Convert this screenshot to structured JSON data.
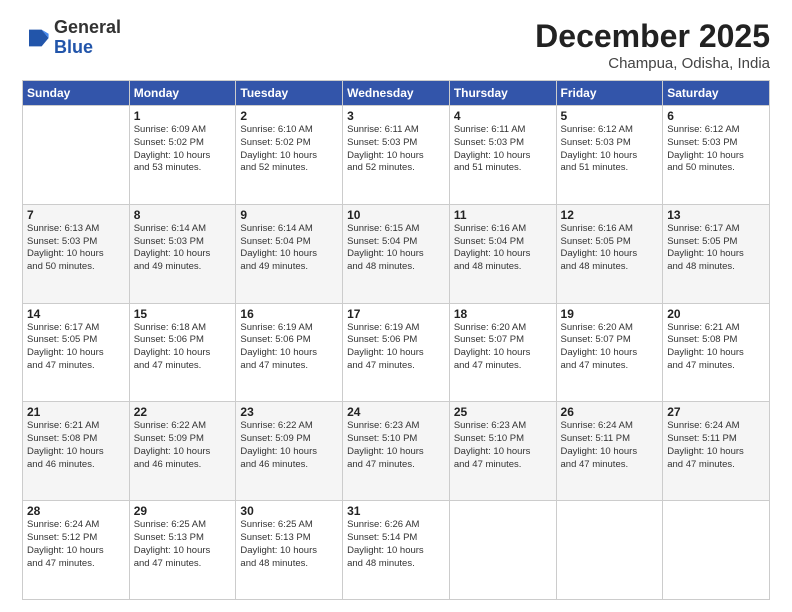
{
  "logo": {
    "general": "General",
    "blue": "Blue"
  },
  "title": "December 2025",
  "location": "Champua, Odisha, India",
  "weekdays": [
    "Sunday",
    "Monday",
    "Tuesday",
    "Wednesday",
    "Thursday",
    "Friday",
    "Saturday"
  ],
  "weeks": [
    [
      {
        "day": "",
        "info": ""
      },
      {
        "day": "1",
        "info": "Sunrise: 6:09 AM\nSunset: 5:02 PM\nDaylight: 10 hours\nand 53 minutes."
      },
      {
        "day": "2",
        "info": "Sunrise: 6:10 AM\nSunset: 5:02 PM\nDaylight: 10 hours\nand 52 minutes."
      },
      {
        "day": "3",
        "info": "Sunrise: 6:11 AM\nSunset: 5:03 PM\nDaylight: 10 hours\nand 52 minutes."
      },
      {
        "day": "4",
        "info": "Sunrise: 6:11 AM\nSunset: 5:03 PM\nDaylight: 10 hours\nand 51 minutes."
      },
      {
        "day": "5",
        "info": "Sunrise: 6:12 AM\nSunset: 5:03 PM\nDaylight: 10 hours\nand 51 minutes."
      },
      {
        "day": "6",
        "info": "Sunrise: 6:12 AM\nSunset: 5:03 PM\nDaylight: 10 hours\nand 50 minutes."
      }
    ],
    [
      {
        "day": "7",
        "info": "Sunrise: 6:13 AM\nSunset: 5:03 PM\nDaylight: 10 hours\nand 50 minutes."
      },
      {
        "day": "8",
        "info": "Sunrise: 6:14 AM\nSunset: 5:03 PM\nDaylight: 10 hours\nand 49 minutes."
      },
      {
        "day": "9",
        "info": "Sunrise: 6:14 AM\nSunset: 5:04 PM\nDaylight: 10 hours\nand 49 minutes."
      },
      {
        "day": "10",
        "info": "Sunrise: 6:15 AM\nSunset: 5:04 PM\nDaylight: 10 hours\nand 48 minutes."
      },
      {
        "day": "11",
        "info": "Sunrise: 6:16 AM\nSunset: 5:04 PM\nDaylight: 10 hours\nand 48 minutes."
      },
      {
        "day": "12",
        "info": "Sunrise: 6:16 AM\nSunset: 5:05 PM\nDaylight: 10 hours\nand 48 minutes."
      },
      {
        "day": "13",
        "info": "Sunrise: 6:17 AM\nSunset: 5:05 PM\nDaylight: 10 hours\nand 48 minutes."
      }
    ],
    [
      {
        "day": "14",
        "info": "Sunrise: 6:17 AM\nSunset: 5:05 PM\nDaylight: 10 hours\nand 47 minutes."
      },
      {
        "day": "15",
        "info": "Sunrise: 6:18 AM\nSunset: 5:06 PM\nDaylight: 10 hours\nand 47 minutes."
      },
      {
        "day": "16",
        "info": "Sunrise: 6:19 AM\nSunset: 5:06 PM\nDaylight: 10 hours\nand 47 minutes."
      },
      {
        "day": "17",
        "info": "Sunrise: 6:19 AM\nSunset: 5:06 PM\nDaylight: 10 hours\nand 47 minutes."
      },
      {
        "day": "18",
        "info": "Sunrise: 6:20 AM\nSunset: 5:07 PM\nDaylight: 10 hours\nand 47 minutes."
      },
      {
        "day": "19",
        "info": "Sunrise: 6:20 AM\nSunset: 5:07 PM\nDaylight: 10 hours\nand 47 minutes."
      },
      {
        "day": "20",
        "info": "Sunrise: 6:21 AM\nSunset: 5:08 PM\nDaylight: 10 hours\nand 47 minutes."
      }
    ],
    [
      {
        "day": "21",
        "info": "Sunrise: 6:21 AM\nSunset: 5:08 PM\nDaylight: 10 hours\nand 46 minutes."
      },
      {
        "day": "22",
        "info": "Sunrise: 6:22 AM\nSunset: 5:09 PM\nDaylight: 10 hours\nand 46 minutes."
      },
      {
        "day": "23",
        "info": "Sunrise: 6:22 AM\nSunset: 5:09 PM\nDaylight: 10 hours\nand 46 minutes."
      },
      {
        "day": "24",
        "info": "Sunrise: 6:23 AM\nSunset: 5:10 PM\nDaylight: 10 hours\nand 47 minutes."
      },
      {
        "day": "25",
        "info": "Sunrise: 6:23 AM\nSunset: 5:10 PM\nDaylight: 10 hours\nand 47 minutes."
      },
      {
        "day": "26",
        "info": "Sunrise: 6:24 AM\nSunset: 5:11 PM\nDaylight: 10 hours\nand 47 minutes."
      },
      {
        "day": "27",
        "info": "Sunrise: 6:24 AM\nSunset: 5:11 PM\nDaylight: 10 hours\nand 47 minutes."
      }
    ],
    [
      {
        "day": "28",
        "info": "Sunrise: 6:24 AM\nSunset: 5:12 PM\nDaylight: 10 hours\nand 47 minutes."
      },
      {
        "day": "29",
        "info": "Sunrise: 6:25 AM\nSunset: 5:13 PM\nDaylight: 10 hours\nand 47 minutes."
      },
      {
        "day": "30",
        "info": "Sunrise: 6:25 AM\nSunset: 5:13 PM\nDaylight: 10 hours\nand 48 minutes."
      },
      {
        "day": "31",
        "info": "Sunrise: 6:26 AM\nSunset: 5:14 PM\nDaylight: 10 hours\nand 48 minutes."
      },
      {
        "day": "",
        "info": ""
      },
      {
        "day": "",
        "info": ""
      },
      {
        "day": "",
        "info": ""
      }
    ]
  ]
}
